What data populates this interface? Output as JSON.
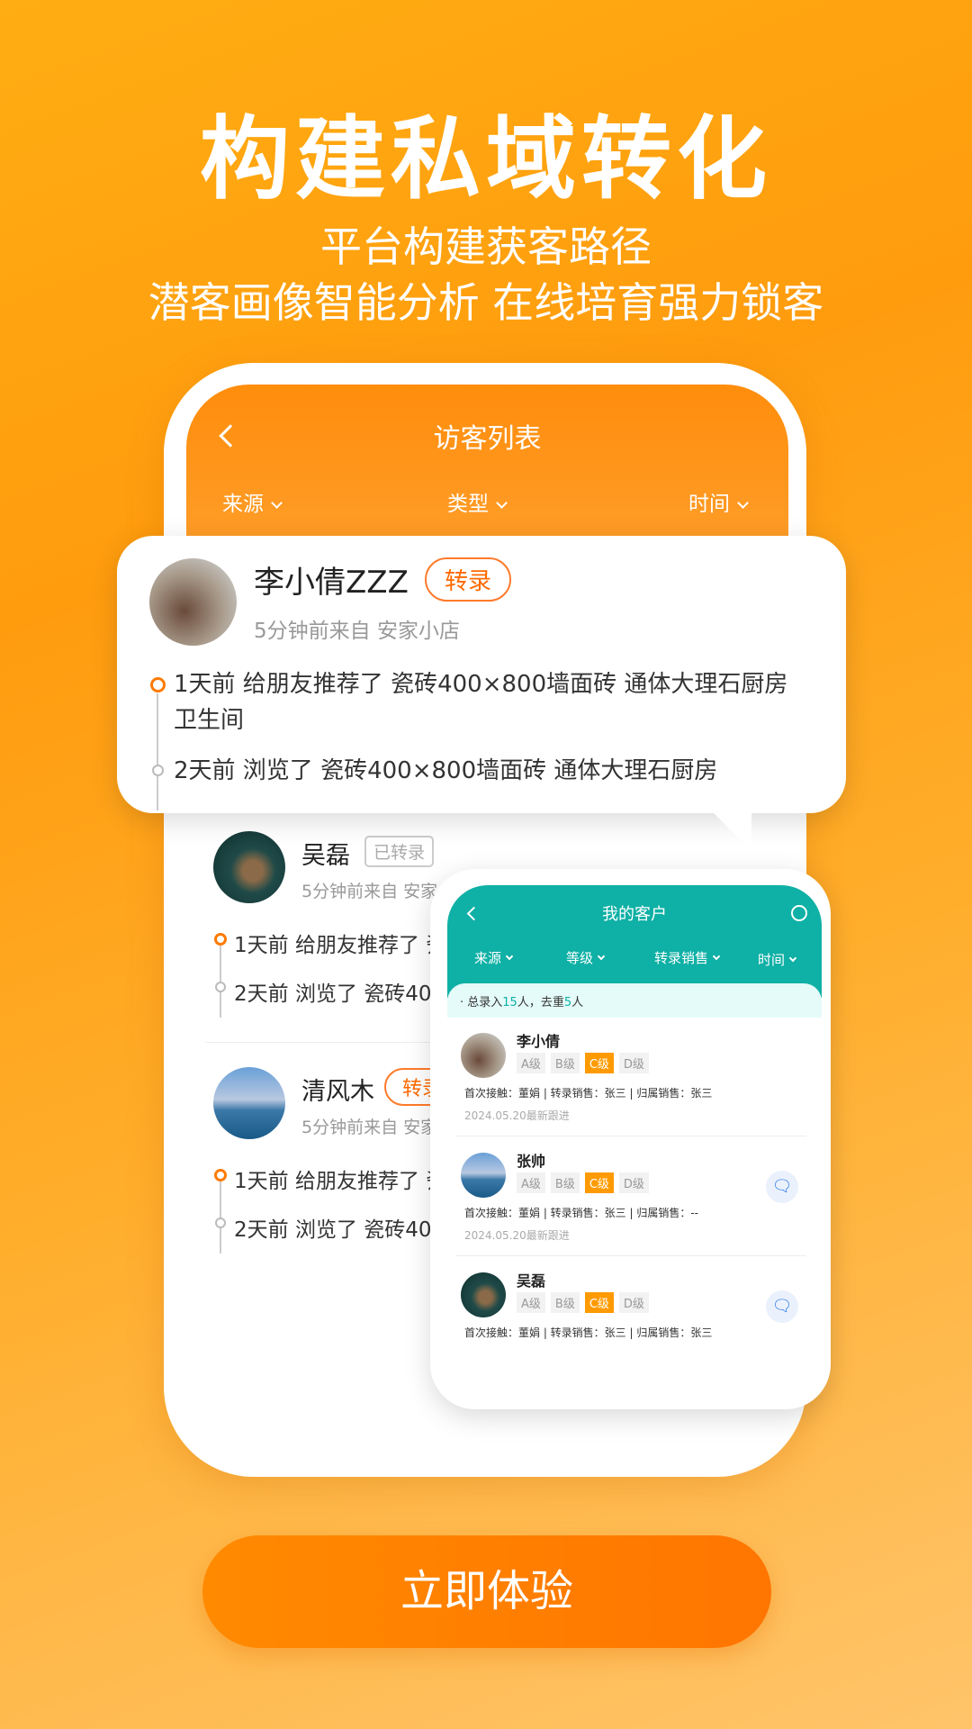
{
  "headline": "构建私域转化",
  "subline1": "平台构建获客路径",
  "subline2": "潜客画像智能分析 在线培育强力锁客",
  "visitor_screen": {
    "title": "访客列表",
    "filters": [
      "来源",
      "类型",
      "时间"
    ]
  },
  "popup": {
    "name": "李小倩ZZZ",
    "badge": "转录",
    "source": "5分钟前来自 安家小店",
    "events": [
      "1天前 给朋友推荐了 瓷砖400×800墙面砖 通体大理石厨房卫生间",
      "2天前 浏览了 瓷砖400×800墙面砖 通体大理石厨房"
    ]
  },
  "visitors": [
    {
      "name": "吴磊",
      "badge": "已转录",
      "source": "5分钟前来自 安家C",
      "events": [
        "1天前 给朋友推荐了 瓷",
        "2天前 浏览了 瓷砖40"
      ]
    },
    {
      "name": "清风木",
      "badge": "转录",
      "source": "5分钟前来自 安家",
      "events": [
        "1天前 给朋友推荐了 瓷",
        "2天前 浏览了 瓷砖40"
      ]
    }
  ],
  "customers_screen": {
    "title": "我的客户",
    "filters": [
      "来源",
      "等级",
      "转录销售",
      "时间"
    ],
    "summary_prefix": "总录入",
    "summary_total": "15",
    "summary_mid": "人，去重",
    "summary_dedup": "5",
    "summary_suffix": "人",
    "levels": [
      "A级",
      "B级",
      "C级",
      "D级"
    ],
    "selected_level": "C级",
    "customers": [
      {
        "name": "李小倩",
        "meta": "首次接触：董娟 | 转录销售：张三 | 归属销售：张三",
        "date": "2024.05.20最新跟进",
        "chat": false
      },
      {
        "name": "张帅",
        "meta": "首次接触：董娟 | 转录销售：张三 | 归属销售：--",
        "date": "2024.05.20最新跟进",
        "chat": true
      },
      {
        "name": "吴磊",
        "meta": "首次接触：董娟 | 转录销售：张三 | 归属销售：张三",
        "date": "",
        "chat": true
      }
    ]
  },
  "cta": "立即体验",
  "colors": {
    "orange": "#ff8a00",
    "teal": "#0fb0a5"
  }
}
